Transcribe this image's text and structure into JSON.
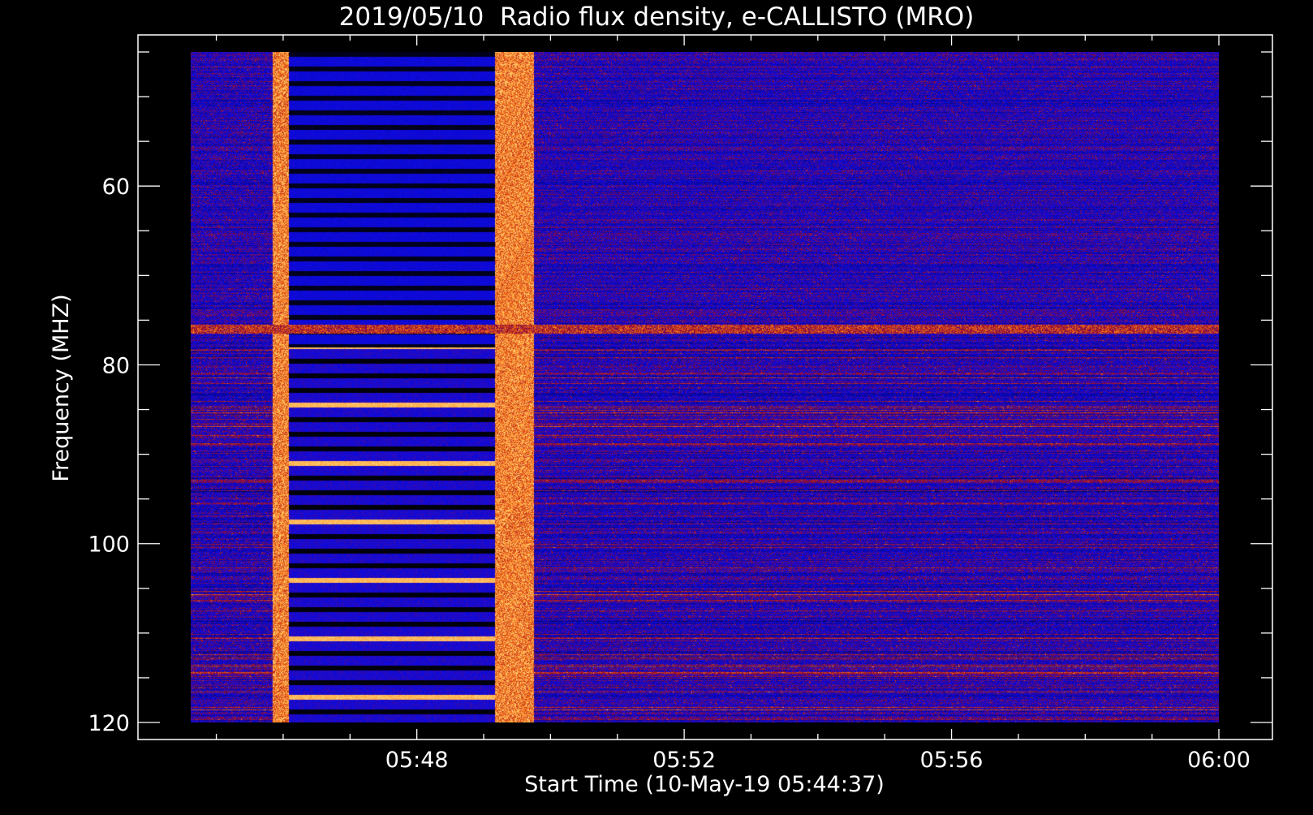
{
  "chart_data": {
    "type": "heatmap",
    "title": "2019/05/10  Radio flux density, e-CALLISTO (MRO)",
    "xlabel": "Start Time (10-May-19 05:44:37)",
    "ylabel": "Frequency (MHZ)",
    "x_range_minutes": [
      "05:44:37",
      "06:00:00"
    ],
    "x_ticks": [
      "05:48",
      "05:52",
      "05:56",
      "06:00"
    ],
    "x_tick_minutes": [
      348,
      352,
      356,
      360
    ],
    "y_range": [
      45,
      120
    ],
    "y_ticks": [
      60,
      80,
      100,
      120
    ],
    "y_inverted": true,
    "colormap": "blue-red-yellow (black low, blue background, red/yellow high)",
    "colors": {
      "background": "#000000",
      "low": "#000000",
      "background_signal": "#2828e0",
      "mid": "#c01010",
      "high": "#ffe060",
      "axes": "#ffffff"
    },
    "features": [
      {
        "name": "burst band",
        "time": [
          "05:45:50",
          "05:46:05"
        ],
        "freq": [
          45,
          120
        ]
      },
      {
        "name": "calibration stripes",
        "time": [
          "05:46:05",
          "05:49:10"
        ],
        "freq": [
          45,
          120
        ]
      },
      {
        "name": "burst band",
        "time": [
          "05:49:10",
          "05:49:45"
        ],
        "freq": [
          45,
          120
        ]
      },
      {
        "name": "RFI line",
        "time": [
          "05:44:37",
          "06:00:00"
        ],
        "freq": [
          76,
          76
        ]
      }
    ],
    "grid": false
  }
}
